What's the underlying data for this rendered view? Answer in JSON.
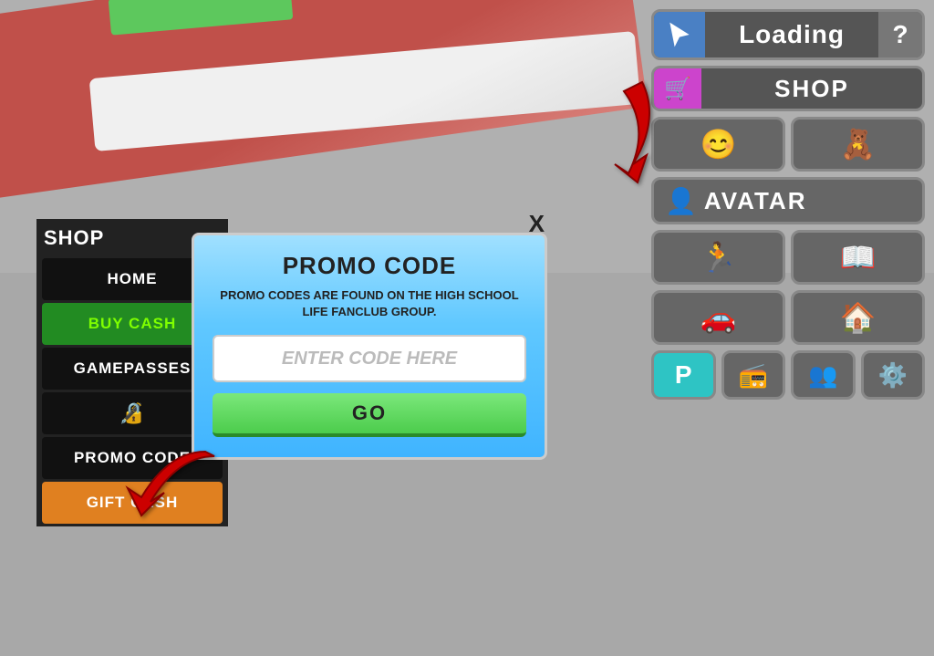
{
  "background": {
    "floor_color": "#a8a8a8"
  },
  "top_right": {
    "loading": {
      "label": "Loading",
      "question": "?"
    },
    "shop_button": {
      "label": "SHOP"
    },
    "avatar_button": {
      "label": "AVATAR"
    },
    "icons": {
      "smiley": "😊",
      "teddy": "🧸",
      "run": "🏃",
      "book": "📖",
      "car": "🚗",
      "house": "🏠",
      "parking": "P",
      "radio": "📻",
      "group": "👥",
      "gear": "⚙️"
    }
  },
  "shop_panel": {
    "title": "SHOP",
    "close": "X",
    "menu_items": [
      {
        "label": "HOME",
        "style": "dark"
      },
      {
        "label": "BUY CASH",
        "style": "green"
      },
      {
        "label": "GAMEPASSES",
        "style": "dark"
      },
      {
        "label": "🔏",
        "style": "dark"
      },
      {
        "label": "PROMO CODE",
        "style": "dark"
      },
      {
        "label": "GIFT CASH",
        "style": "orange"
      }
    ]
  },
  "promo_dialog": {
    "title": "PROMO CODE",
    "description": "PROMO CODES ARE FOUND ON THE HIGH\nSCHOOL LIFE FANCLUB GROUP.",
    "input_placeholder": "ENTER CODE HERE",
    "go_button": "GO"
  }
}
